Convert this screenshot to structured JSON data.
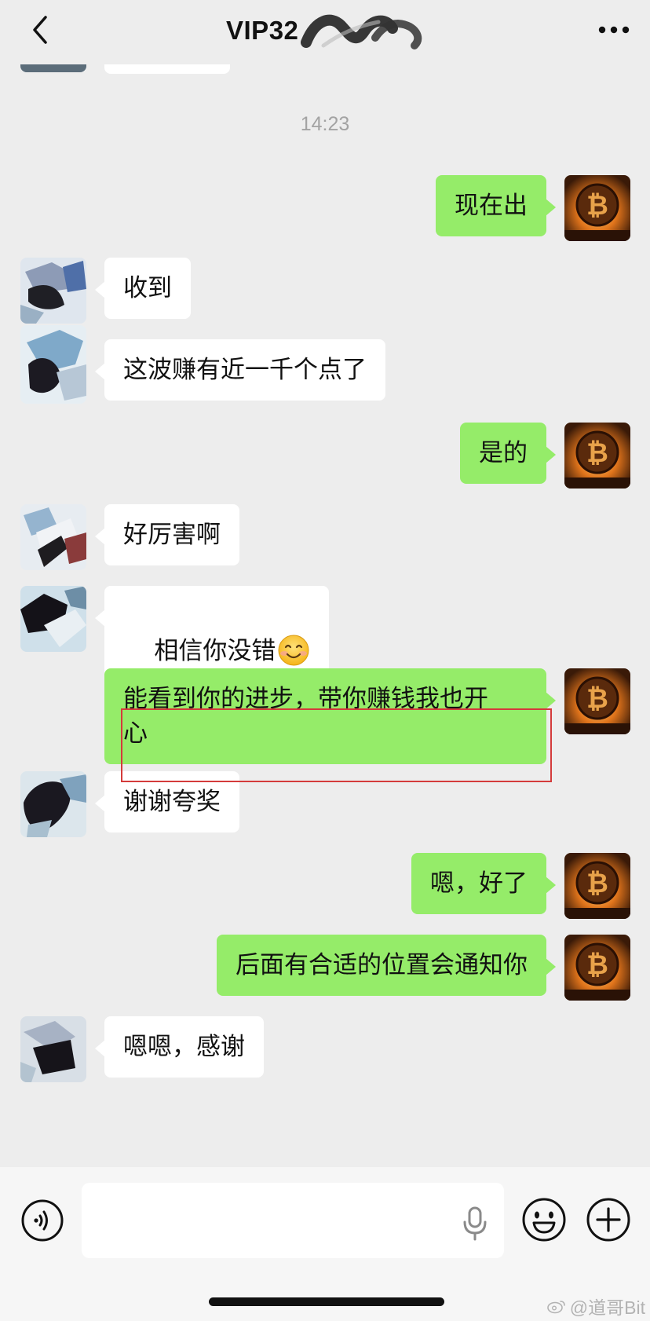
{
  "header": {
    "title": "VIP32",
    "back_icon": "chevron-left-icon",
    "more_icon": "more-dots-icon"
  },
  "timestamp": "14:23",
  "messages": [
    {
      "side": "out",
      "text": "现在出"
    },
    {
      "side": "in",
      "text": "收到"
    },
    {
      "side": "in",
      "text": "这波赚有近一千个点了"
    },
    {
      "side": "out",
      "text": "是的"
    },
    {
      "side": "in",
      "text": "好厉害啊"
    },
    {
      "side": "in",
      "text": "相信你没错",
      "emoji": "smiling-face-emoji"
    },
    {
      "side": "out",
      "text": "能看到你的进步，带你赚钱我也开\n心",
      "highlighted": true
    },
    {
      "side": "in",
      "text": "谢谢夸奖"
    },
    {
      "side": "out",
      "text": "嗯，好了"
    },
    {
      "side": "out",
      "text": "后面有合适的位置会通知你"
    },
    {
      "side": "in",
      "text": "嗯嗯，感谢"
    }
  ],
  "input_bar": {
    "value": "",
    "voice_icon": "voice-icon",
    "mic_icon": "mic-icon",
    "emoji_icon": "emoji-icon",
    "plus_icon": "plus-icon"
  },
  "watermark": "@道哥Bit",
  "colors": {
    "background": "#ededed",
    "outgoing_bubble": "#95ec69",
    "incoming_bubble": "#ffffff",
    "highlight_border": "#d43b3b"
  }
}
